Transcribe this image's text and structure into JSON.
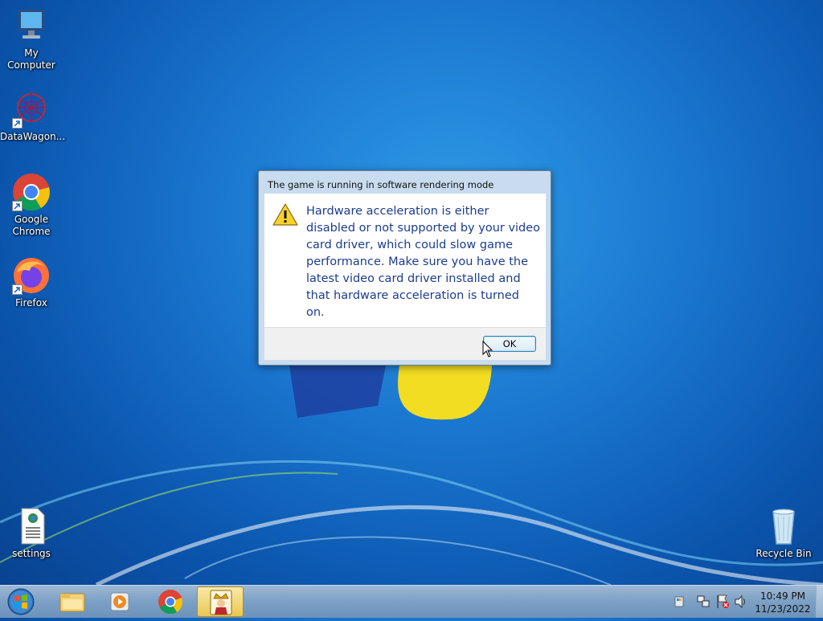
{
  "desktop": {
    "icons": [
      {
        "name": "My Computer"
      },
      {
        "name": "DataWagon..."
      },
      {
        "name": "Google Chrome"
      },
      {
        "name": "Firefox"
      },
      {
        "name": "settings"
      },
      {
        "name": "Recycle Bin"
      }
    ]
  },
  "dialog": {
    "title": "The game is running in software rendering mode",
    "message": "Hardware acceleration is either disabled or not supported by your video card driver, which could slow game performance. Make sure you have the latest video card driver installed and that hardware acceleration is turned on.",
    "ok_label": "OK",
    "icon": "warning-icon"
  },
  "taskbar": {
    "items": [
      {
        "icon": "windows-start-icon"
      },
      {
        "icon": "file-explorer-icon"
      },
      {
        "icon": "media-player-icon"
      },
      {
        "icon": "google-chrome-icon"
      },
      {
        "icon": "solitaire-king-icon",
        "active": true
      }
    ],
    "tray": {
      "time": "10:49 PM",
      "date": "11/23/2022"
    }
  },
  "colors": {
    "desktop_blue": "#1a76cf",
    "dialog_text": "#1b3d8f",
    "ok_border": "#3c7fb1"
  }
}
